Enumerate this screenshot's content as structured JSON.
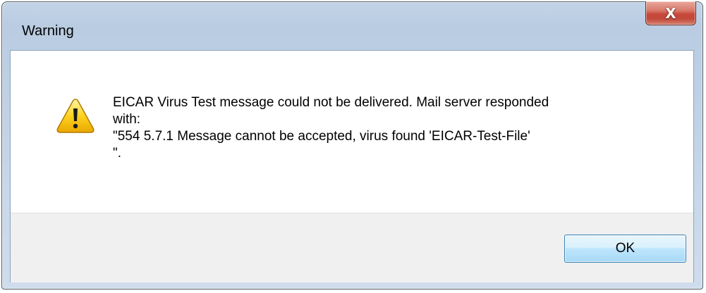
{
  "window": {
    "title": "Warning",
    "close_symbol": "X"
  },
  "message": {
    "icon": "warning-icon",
    "lines": [
      "EICAR Virus Test message could not be delivered. Mail server responded",
      "with:",
      "\"554 5.7.1 Message cannot be accepted, virus found 'EICAR-Test-File'",
      "\"."
    ]
  },
  "buttons": {
    "ok_label": "OK"
  },
  "colors": {
    "close_button": "#c7473a",
    "warning_yellow": "#f5c400",
    "footer_background": "#f0f0f0",
    "frame": "#bed0e4"
  }
}
